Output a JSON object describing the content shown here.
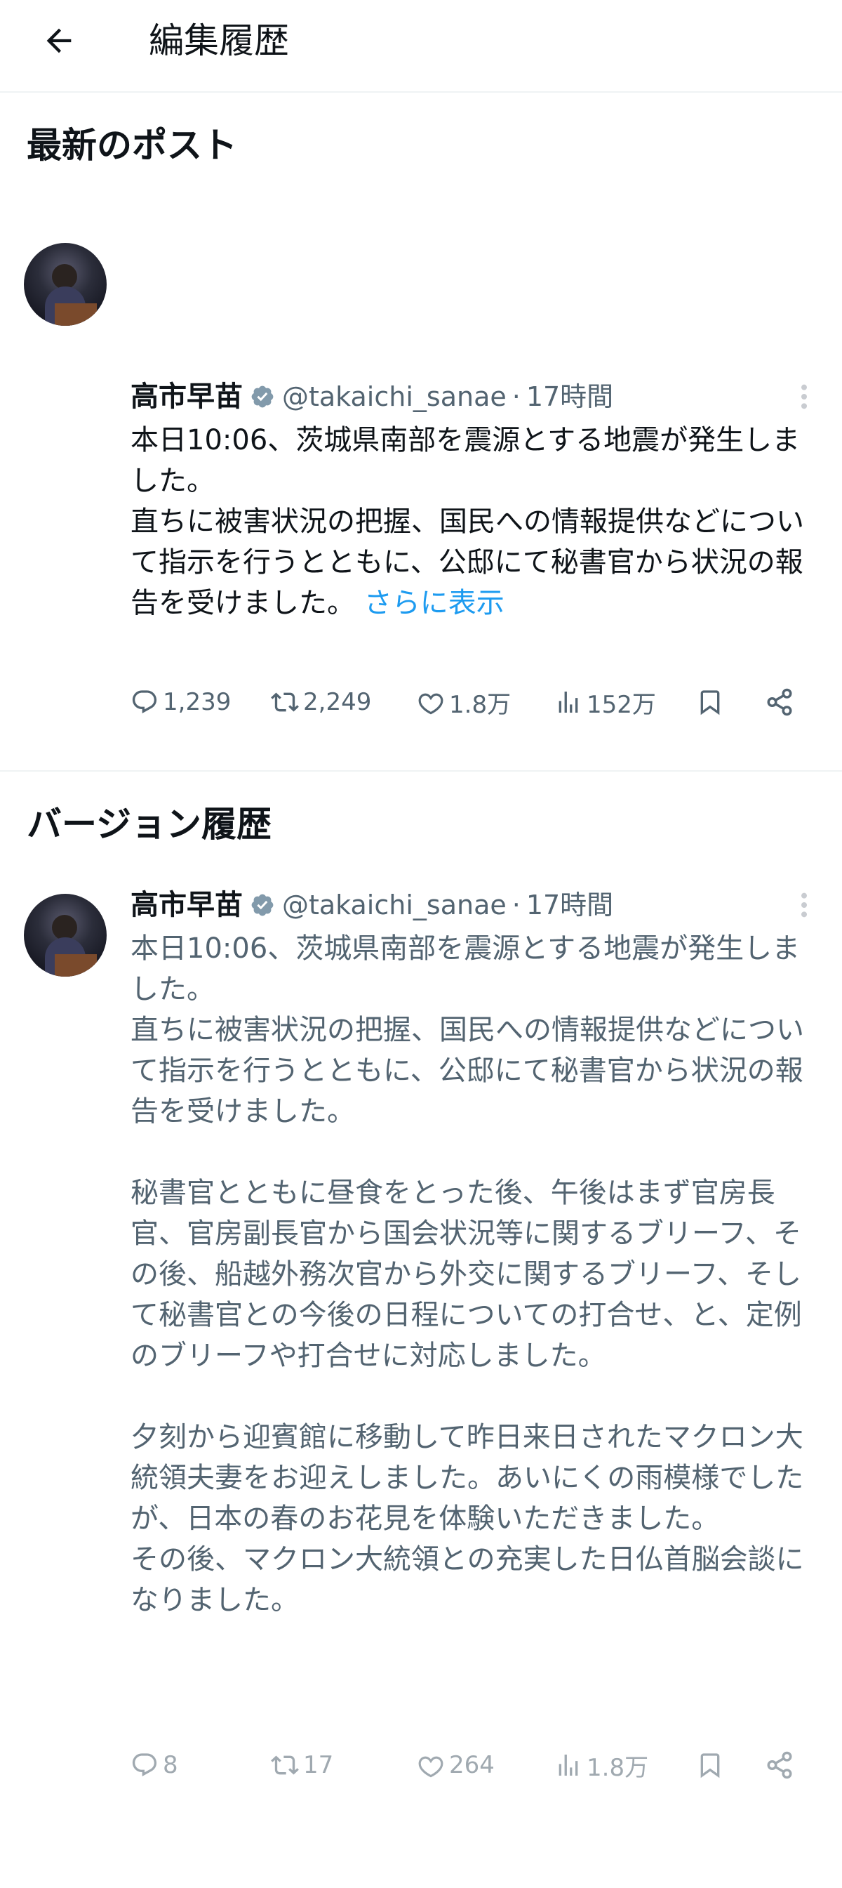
{
  "header": {
    "title": "編集履歴",
    "back_icon": "arrow-left-icon"
  },
  "latest": {
    "section_title": "最新のポスト",
    "post": {
      "name": "高市早苗",
      "handle": "@takaichi_sanae",
      "separator": "·",
      "time": "17時間",
      "text": "本日10:06、茨城県南部を震源とする地震が発生しました。\n直ちに被害状況の把握、国民への情報提供などについて指示を行うとともに、公邸にて秘書官から状況の報告を受けました。 ",
      "show_more": "さらに表示",
      "replies": "1,239",
      "retweets": "2,249",
      "likes": "1.8万",
      "views": "152万"
    }
  },
  "history": {
    "section_title": "バージョン履歴",
    "post": {
      "name": "高市早苗",
      "handle": "@takaichi_sanae",
      "separator": "·",
      "time": "17時間",
      "text": "本日10:06、茨城県南部を震源とする地震が発生しました。\n直ちに被害状況の把握、国民への情報提供などについて指示を行うとともに、公邸にて秘書官から状況の報告を受けました。\n\n秘書官とともに昼食をとった後、午後はまず官房長官、官房副長官から国会状況等に関するブリーフ、その後、船越外務次官から外交に関するブリーフ、そして秘書官との今後の日程についての打合せ、と、定例のブリーフや打合せに対応しました。\n\n夕刻から迎賓館に移動して昨日来日されたマクロン大統領夫妻をお迎えしました。あいにくの雨模様でしたが、日本の春のお花見を体験いただきました。\nその後、マクロン大統領との充実した日仏首脳会談になりました。",
      "replies": "8",
      "retweets": "17",
      "likes": "264",
      "views": "1.8万"
    }
  },
  "colors": {
    "accent": "#1d9bf0",
    "muted": "#536471",
    "verified": "#829aab"
  }
}
